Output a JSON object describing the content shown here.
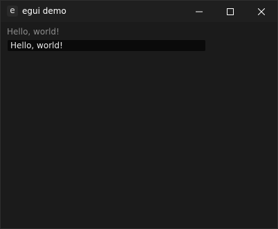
{
  "window": {
    "title": "egui demo",
    "app_icon_glyph": "e",
    "controls": {
      "minimize_icon": "minimize-icon",
      "maximize_icon": "maximize-icon",
      "close_icon": "close-icon"
    }
  },
  "content": {
    "label": "Hello, world!",
    "text_input": {
      "value": "Hello, world!",
      "placeholder": ""
    }
  },
  "colors": {
    "background": "#1b1b1b",
    "titlebar": "#1f1f1f",
    "label_text": "#8c8c8c",
    "input_bg": "#0a0a0a",
    "input_text": "#e8e8e8"
  }
}
